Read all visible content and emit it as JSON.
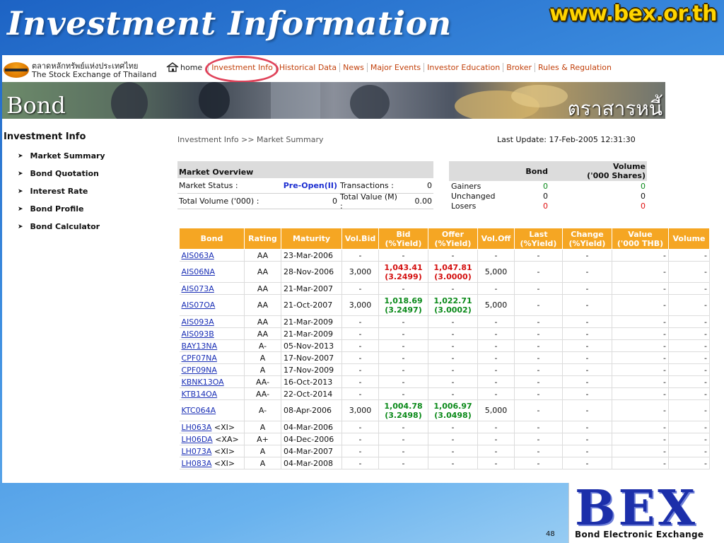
{
  "slide": {
    "title": "Investment Information",
    "url": "www.bex.or.th",
    "page_number": "48"
  },
  "logo": {
    "thai": "ตลาดหลักทรัพย์แห่งประเทศไทย",
    "english": "The Stock Exchange of Thailand"
  },
  "nav": {
    "home": "home",
    "items": [
      "Investment Info",
      "Historical Data",
      "News",
      "Major Events",
      "Investor Education",
      "Broker",
      "Rules & Regulation"
    ]
  },
  "banner": {
    "english": "Bond",
    "thai": "ตราสารหนี้"
  },
  "sidebar": {
    "heading": "Investment Info",
    "items": [
      "Market Summary",
      "Bond Quotation",
      "Interest Rate",
      "Bond Profile",
      "Bond Calculator"
    ]
  },
  "breadcrumb": "Investment Info >> Market Summary",
  "last_update": "Last Update: 17-Feb-2005 12:31:30",
  "market_overview": {
    "title": "Market Overview",
    "status_label": "Market Status :",
    "status_value": "Pre-Open(II)",
    "transactions_label": "Transactions :",
    "transactions_value": "0",
    "total_volume_label": "Total Volume ('000) :",
    "total_volume_value": "0",
    "total_value_label": "Total Value (M) :",
    "total_value_value": "0.00"
  },
  "gainers": {
    "header_bond": "Bond",
    "header_volume_1": "Volume",
    "header_volume_2": "('000 Shares)",
    "rows": [
      {
        "label": "Gainers",
        "bond": "0",
        "volume": "0"
      },
      {
        "label": "Unchanged",
        "bond": "0",
        "volume": "0"
      },
      {
        "label": "Losers",
        "bond": "0",
        "volume": "0"
      }
    ]
  },
  "bond_table": {
    "headers": [
      "Bond",
      "Rating",
      "Maturity",
      "Vol.Bid",
      "Bid\n(%Yield)",
      "Offer\n(%Yield)",
      "Vol.Off",
      "Last\n(%Yield)",
      "Change\n(%Yield)",
      "Value\n('000 THB)",
      "Volume"
    ],
    "rows": [
      {
        "bond": "AIS063A",
        "tag": "",
        "rating": "AA",
        "maturity": "23-Mar-2006",
        "vol_bid": "-",
        "bid": "-",
        "bid_yield": "",
        "offer": "-",
        "offer_yield": "",
        "vol_off": "-",
        "last": "-",
        "change": "-",
        "value": "-",
        "volume": "-"
      },
      {
        "bond": "AIS06NA",
        "tag": "",
        "rating": "AA",
        "maturity": "28-Nov-2006",
        "vol_bid": "3,000",
        "bid": "1,043.41",
        "bid_yield": "(3.2499)",
        "offer": "1,047.81",
        "offer_yield": "(3.0000)",
        "vol_off": "5,000",
        "last": "-",
        "change": "-",
        "value": "-",
        "volume": "-"
      },
      {
        "bond": "AIS073A",
        "tag": "",
        "rating": "AA",
        "maturity": "21-Mar-2007",
        "vol_bid": "-",
        "bid": "-",
        "bid_yield": "",
        "offer": "-",
        "offer_yield": "",
        "vol_off": "-",
        "last": "-",
        "change": "-",
        "value": "-",
        "volume": "-"
      },
      {
        "bond": "AIS07OA",
        "tag": "",
        "rating": "AA",
        "maturity": "21-Oct-2007",
        "vol_bid": "3,000",
        "bid": "1,018.69",
        "bid_yield": "(3.2497)",
        "offer": "1,022.71",
        "offer_yield": "(3.0002)",
        "vol_off": "5,000",
        "last": "-",
        "change": "-",
        "value": "-",
        "volume": "-"
      },
      {
        "bond": "AIS093A",
        "tag": "",
        "rating": "AA",
        "maturity": "21-Mar-2009",
        "vol_bid": "-",
        "bid": "-",
        "bid_yield": "",
        "offer": "-",
        "offer_yield": "",
        "vol_off": "-",
        "last": "-",
        "change": "-",
        "value": "-",
        "volume": "-"
      },
      {
        "bond": "AIS093B",
        "tag": "",
        "rating": "AA",
        "maturity": "21-Mar-2009",
        "vol_bid": "-",
        "bid": "-",
        "bid_yield": "",
        "offer": "-",
        "offer_yield": "",
        "vol_off": "-",
        "last": "-",
        "change": "-",
        "value": "-",
        "volume": "-"
      },
      {
        "bond": "BAY13NA",
        "tag": "",
        "rating": "A-",
        "maturity": "05-Nov-2013",
        "vol_bid": "-",
        "bid": "-",
        "bid_yield": "",
        "offer": "-",
        "offer_yield": "",
        "vol_off": "-",
        "last": "-",
        "change": "-",
        "value": "-",
        "volume": "-"
      },
      {
        "bond": "CPF07NA",
        "tag": "",
        "rating": "A",
        "maturity": "17-Nov-2007",
        "vol_bid": "-",
        "bid": "-",
        "bid_yield": "",
        "offer": "-",
        "offer_yield": "",
        "vol_off": "-",
        "last": "-",
        "change": "-",
        "value": "-",
        "volume": "-"
      },
      {
        "bond": "CPF09NA",
        "tag": "",
        "rating": "A",
        "maturity": "17-Nov-2009",
        "vol_bid": "-",
        "bid": "-",
        "bid_yield": "",
        "offer": "-",
        "offer_yield": "",
        "vol_off": "-",
        "last": "-",
        "change": "-",
        "value": "-",
        "volume": "-"
      },
      {
        "bond": "KBNK13OA",
        "tag": "",
        "rating": "AA-",
        "maturity": "16-Oct-2013",
        "vol_bid": "-",
        "bid": "-",
        "bid_yield": "",
        "offer": "-",
        "offer_yield": "",
        "vol_off": "-",
        "last": "-",
        "change": "-",
        "value": "-",
        "volume": "-"
      },
      {
        "bond": "KTB14OA",
        "tag": "",
        "rating": "AA-",
        "maturity": "22-Oct-2014",
        "vol_bid": "-",
        "bid": "-",
        "bid_yield": "",
        "offer": "-",
        "offer_yield": "",
        "vol_off": "-",
        "last": "-",
        "change": "-",
        "value": "-",
        "volume": "-"
      },
      {
        "bond": "KTC064A",
        "tag": "",
        "rating": "A-",
        "maturity": "08-Apr-2006",
        "vol_bid": "3,000",
        "bid": "1,004.78",
        "bid_yield": "(3.2498)",
        "offer": "1,006.97",
        "offer_yield": "(3.0498)",
        "vol_off": "5,000",
        "last": "-",
        "change": "-",
        "value": "-",
        "volume": "-"
      },
      {
        "bond": "LH063A",
        "tag": "<XI>",
        "rating": "A",
        "maturity": "04-Mar-2006",
        "vol_bid": "-",
        "bid": "-",
        "bid_yield": "",
        "offer": "-",
        "offer_yield": "",
        "vol_off": "-",
        "last": "-",
        "change": "-",
        "value": "-",
        "volume": "-"
      },
      {
        "bond": "LH06DA",
        "tag": "<XA>",
        "rating": "A+",
        "maturity": "04-Dec-2006",
        "vol_bid": "-",
        "bid": "-",
        "bid_yield": "",
        "offer": "-",
        "offer_yield": "",
        "vol_off": "-",
        "last": "-",
        "change": "-",
        "value": "-",
        "volume": "-"
      },
      {
        "bond": "LH073A",
        "tag": "<XI>",
        "rating": "A",
        "maturity": "04-Mar-2007",
        "vol_bid": "-",
        "bid": "-",
        "bid_yield": "",
        "offer": "-",
        "offer_yield": "",
        "vol_off": "-",
        "last": "-",
        "change": "-",
        "value": "-",
        "volume": "-"
      },
      {
        "bond": "LH083A",
        "tag": "<XI>",
        "rating": "A",
        "maturity": "04-Mar-2008",
        "vol_bid": "-",
        "bid": "-",
        "bid_yield": "",
        "offer": "-",
        "offer_yield": "",
        "vol_off": "-",
        "last": "-",
        "change": "-",
        "value": "-",
        "volume": "-"
      }
    ]
  },
  "bex": {
    "letters": "BEX",
    "caption": "Bond  Electronic  Exchange"
  },
  "colors": {
    "table_header": "#f5a623",
    "link": "#1a2fb5",
    "bid_offer_red": "#d40f0f",
    "bid_offer_green": "#0b8a1a",
    "status_blue": "#1d2fd1",
    "bex_blue": "#1c2faa",
    "url_yellow": "#ffd400"
  },
  "icons": {
    "home": "home-icon",
    "bullet": "arrow-right-icon"
  }
}
